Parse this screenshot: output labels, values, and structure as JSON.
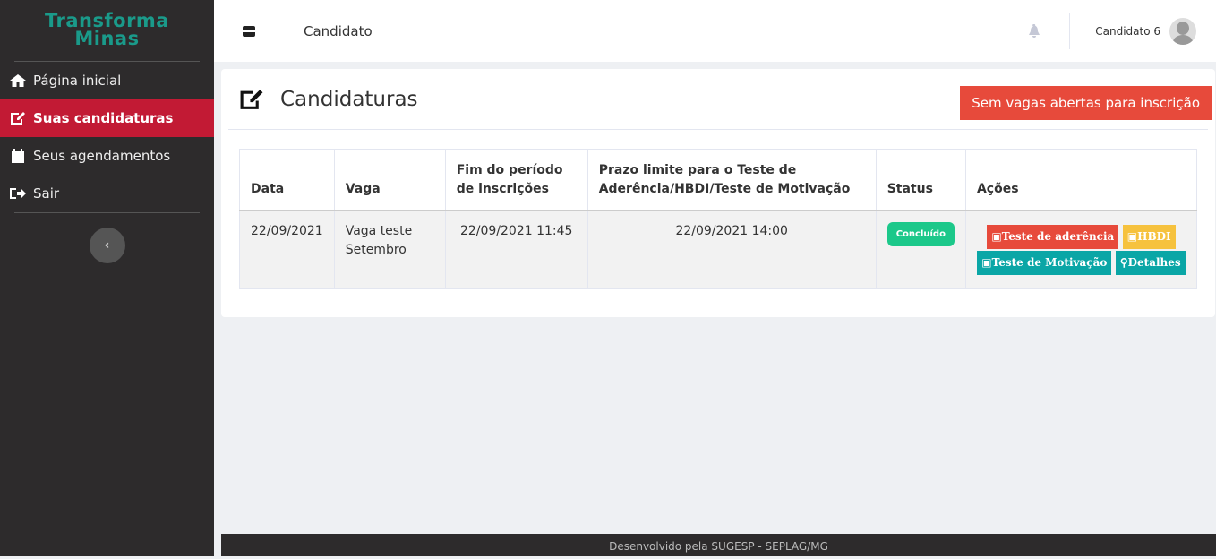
{
  "sidebar": {
    "logo_line1": "Transforma",
    "logo_line2": "Minas",
    "items": [
      {
        "label": "Página inicial"
      },
      {
        "label": "Suas candidaturas"
      },
      {
        "label": "Seus agendamentos"
      },
      {
        "label": "Sair"
      }
    ],
    "collapse": "‹"
  },
  "topbar": {
    "title": "Candidato",
    "user": "Candidato 6"
  },
  "page": {
    "title": "Candidaturas",
    "closed_button": "Sem vagas abertas para inscrição"
  },
  "table": {
    "headers": [
      "Data",
      "Vaga",
      "Fim do período de inscrições",
      "Prazo limite para o Teste de Aderência/HBDI/Teste de Motivação",
      "Status",
      "Ações"
    ],
    "rows": [
      {
        "data": "22/09/2021",
        "vaga": "Vaga teste Setembro",
        "fim": "22/09/2021 11:45",
        "prazo": "22/09/2021 14:00",
        "status": "Concluído",
        "actions": [
          "Teste de aderência",
          "HBDI",
          "Teste de Motivação",
          "Detalhes"
        ]
      }
    ]
  },
  "footer": "Desenvolvido pela SUGESP - SEPLAG/MG"
}
